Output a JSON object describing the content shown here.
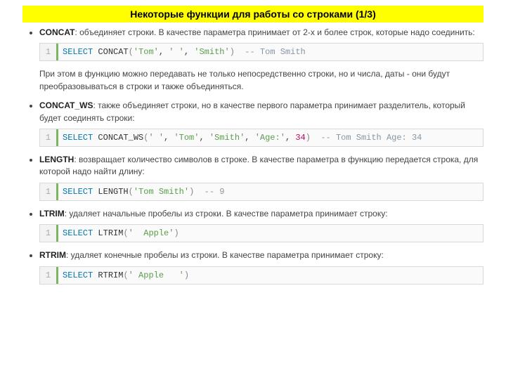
{
  "header": {
    "title": "Некоторые функции для работы со строками (1/3)"
  },
  "items": [
    {
      "fn": "CONCAT",
      "desc": ": объединяет строки. В качестве параметра принимает от 2-х и более строк, которые надо соединить:",
      "code": {
        "lineno": "1",
        "kw": "SELECT ",
        "fn": "CONCAT",
        "open": "(",
        "args": [
          {
            "t": "str",
            "v": "'Tom'"
          },
          {
            "t": "sep",
            "v": ", "
          },
          {
            "t": "str",
            "v": "' '"
          },
          {
            "t": "sep",
            "v": ", "
          },
          {
            "t": "str",
            "v": "'Smith'"
          }
        ],
        "close": ")",
        "cmt": "  -- Tom Smith"
      },
      "note": "При этом в функцию можно передавать не только непосредственно строки, но и числа, даты - они будут преобразовываться в строки и также объединяться."
    },
    {
      "fn": "CONCAT_WS",
      "desc": ": также объединяет строки, но в качестве первого параметра принимает разделитель, который будет соединять строки:",
      "code": {
        "lineno": "1",
        "kw": "SELECT ",
        "fn": "CONCAT_WS",
        "open": "(",
        "args": [
          {
            "t": "str",
            "v": "' '"
          },
          {
            "t": "sep",
            "v": ", "
          },
          {
            "t": "str",
            "v": "'Tom'"
          },
          {
            "t": "sep",
            "v": ", "
          },
          {
            "t": "str",
            "v": "'Smith'"
          },
          {
            "t": "sep",
            "v": ", "
          },
          {
            "t": "str",
            "v": "'Age:'"
          },
          {
            "t": "sep",
            "v": ", "
          },
          {
            "t": "num",
            "v": "34"
          }
        ],
        "close": ")",
        "cmt": "  -- Tom Smith Age: 34"
      }
    },
    {
      "fn": "LENGTH",
      "desc": ": возвращает количество символов в строке. В качестве параметра в функцию передается строка, для которой надо найти длину:",
      "code": {
        "lineno": "1",
        "kw": "SELECT ",
        "fn": "LENGTH",
        "open": "(",
        "args": [
          {
            "t": "str",
            "v": "'Tom Smith'"
          }
        ],
        "close": ")",
        "cmt": "  -- 9"
      }
    },
    {
      "fn": "LTRIM",
      "desc": ": удаляет начальные пробелы из строки. В качестве параметра принимает строку:",
      "code": {
        "lineno": "1",
        "kw": "SELECT ",
        "fn": "LTRIM",
        "open": "(",
        "args": [
          {
            "t": "str",
            "v": "'  Apple'"
          }
        ],
        "close": ")",
        "cmt": ""
      }
    },
    {
      "fn": "RTRIM",
      "desc": ": удаляет конечные пробелы из строки. В качестве параметра принимает строку:",
      "code": {
        "lineno": "1",
        "kw": "SELECT ",
        "fn": "RTRIM",
        "open": "(",
        "args": [
          {
            "t": "str",
            "v": "' Apple   '"
          }
        ],
        "close": ")",
        "cmt": ""
      }
    }
  ]
}
